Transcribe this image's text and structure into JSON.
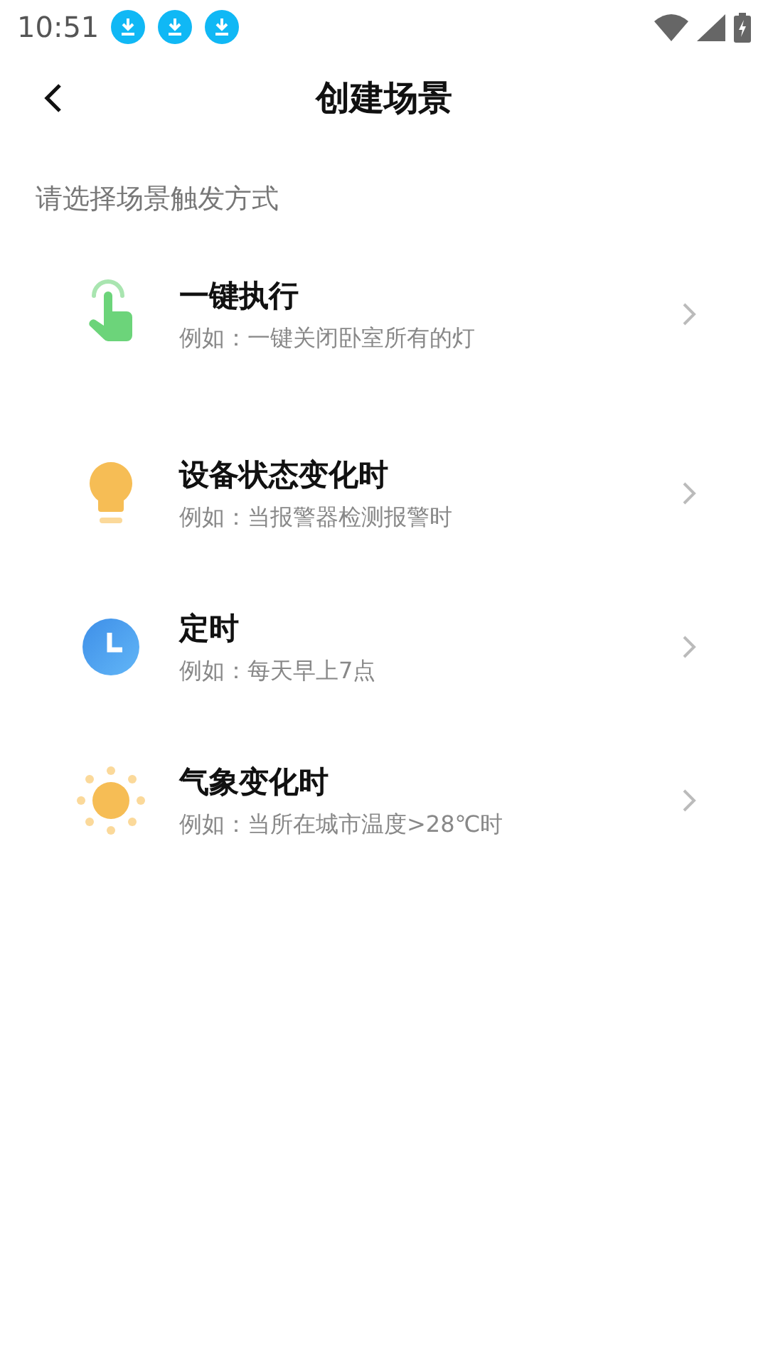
{
  "status_bar": {
    "time": "10:51",
    "notifications": [
      {
        "kind": "download"
      },
      {
        "kind": "download"
      },
      {
        "kind": "download"
      }
    ]
  },
  "header": {
    "title": "创建场景"
  },
  "section_label": "请选择场景触发方式",
  "options": [
    {
      "kind": "tap",
      "title": "一键执行",
      "example": "例如：一键关闭卧室所有的灯"
    },
    {
      "kind": "bulb",
      "title": "设备状态变化时",
      "example": "例如：当报警器检测报警时"
    },
    {
      "kind": "clock",
      "title": "定时",
      "example": "例如：每天早上7点"
    },
    {
      "kind": "weather",
      "title": "气象变化时",
      "example": "例如：当所在城市温度>28℃时"
    }
  ]
}
